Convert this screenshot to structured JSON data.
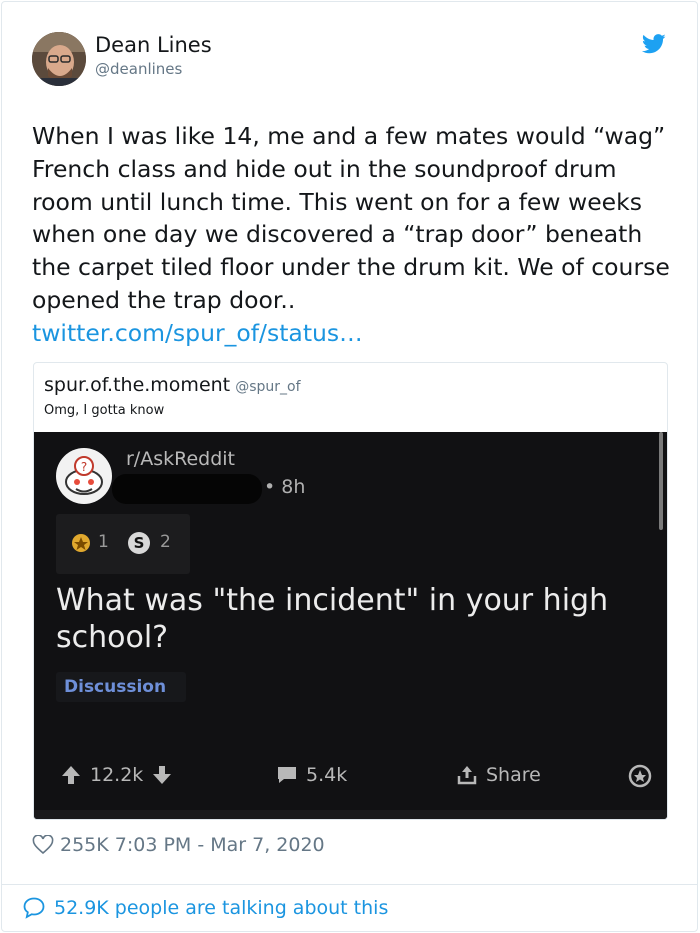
{
  "tweet": {
    "author_name": "Dean Lines",
    "author_handle": "@deanlines",
    "text": "When I was like 14, me and a few mates would “wag” French class and hide out in the soundproof drum room until lunch time. This went on for a few weeks when one day we discovered a “trap door” beneath the carpet tiled floor under the drum kit. We of course opened the trap door..",
    "link": "twitter.com/spur_of/status…",
    "likes": "255K",
    "time": "7:03 PM - Mar 7, 2020",
    "talking": "52.9K people are talking about this"
  },
  "quote": {
    "name": "spur.of.the.moment",
    "handle": "@spur_of",
    "text": "Omg, I gotta know"
  },
  "reddit_post": {
    "subreddit": "r/AskReddit",
    "age": "• 8h",
    "award_gold_count": "1",
    "award_silver_count": "2",
    "silver_glyph": "S",
    "title": "What was \"the incident\" in your high school?",
    "flair": "Discussion",
    "upvotes": "12.2k",
    "comments": "5.4k",
    "share": "Share"
  },
  "colors": {
    "twitter_blue": "#1b95e0",
    "text_primary": "#14171a",
    "text_secondary": "#657786",
    "reddit_bg": "#111113",
    "flair_blue": "#6e8fd8"
  },
  "icons": [
    "twitter-bird-icon",
    "heart-icon",
    "speech-bubble-icon",
    "upvote-arrow-icon",
    "downvote-arrow-icon",
    "comment-icon",
    "share-icon",
    "gold-award-icon",
    "silver-award-icon",
    "snoo-avatar-icon"
  ]
}
